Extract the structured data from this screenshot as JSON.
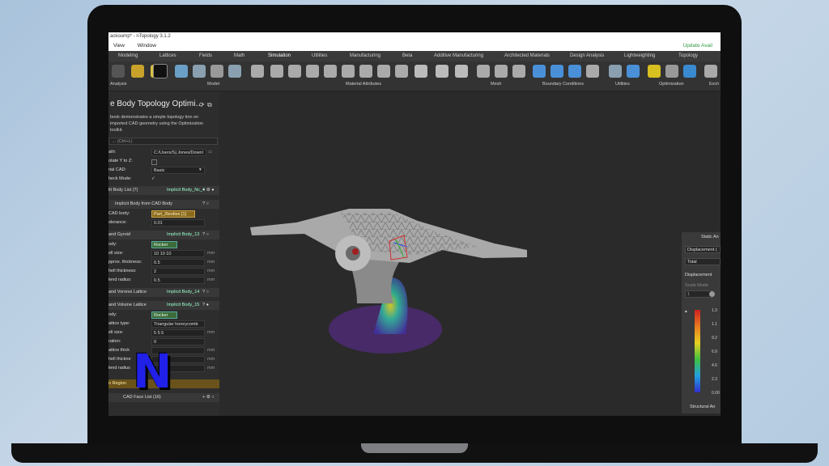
{
  "window": {
    "title": "ackournp* - nTopology 3.1.2",
    "update_link": "Update Avail"
  },
  "menu": [
    "View",
    "Window"
  ],
  "tabs": [
    "Modeling",
    "Lattices",
    "Fields",
    "Math",
    "Simulation",
    "Utilities",
    "Manufacturing",
    "Beta",
    "Additive Manufacturing",
    "Architected Materials",
    "Design Analysis",
    "Lightweighting",
    "Topology Optimizatio"
  ],
  "active_tab": "Simulation",
  "ribbon_groups": [
    "Analysis",
    "Model",
    "Material Attributes",
    "Mesh",
    "Boundary Conditions",
    "Utilities",
    "Optimization",
    "Exch"
  ],
  "notebook": {
    "title": "e Body Topology Optimi…",
    "description": "book demonstrates a simple topology tion on imported CAD geometry using the Optimization toolkit.",
    "search_placeholder": "… (Ctrl+L)",
    "inputs": [
      {
        "label": "ath:",
        "value": "C:/Users/Sj Jones/Downl"
      },
      {
        "label": "otate Y to Z:",
        "value": ""
      },
      {
        "label": "rial CAD:",
        "value": "Basic"
      },
      {
        "label": "heck Mode:",
        "value": "✓"
      }
    ]
  },
  "blocks": [
    {
      "head": "lit Body List (7)",
      "var": "Implicit Body_Nc_4",
      "rows": []
    },
    {
      "head": "Implicit Body from CAD Body",
      "var": "",
      "rows": [
        {
          "label": "CAD body:",
          "value": "Part_2bodies [1]",
          "unit": ""
        },
        {
          "label": "olerance:",
          "value": "0.01",
          "unit": ""
        }
      ]
    },
    {
      "head": "and Gyroid",
      "var": "Implicit Body_13",
      "rows": [
        {
          "label": "ody:",
          "value": "Rocker",
          "unit": ""
        },
        {
          "label": "ell size:",
          "value": "10  10  10",
          "unit": "mm"
        },
        {
          "label": "pprox. thickness:",
          "value": "0.5",
          "unit": "mm"
        },
        {
          "label": "hell thickness:",
          "value": "2",
          "unit": "mm"
        },
        {
          "label": "lend radius:",
          "value": "0.5",
          "unit": "mm"
        }
      ]
    },
    {
      "head": "and Voronoi Lattice",
      "var": "Implicit Body_14",
      "rows": []
    },
    {
      "head": "and Volume Lattice",
      "var": "Implicit Body_15",
      "rows": [
        {
          "label": "ody:",
          "value": "Rocker",
          "unit": ""
        },
        {
          "label": "attice type:",
          "value": "Triangular honeycomb",
          "unit": ""
        },
        {
          "label": "ell size:",
          "value": "5  5  5",
          "unit": "mm"
        },
        {
          "label": "ration:",
          "value": "0",
          "unit": ""
        },
        {
          "label": "attice thick",
          "value": "",
          "unit": "mm"
        },
        {
          "label": "hell thickne",
          "value": "",
          "unit": "mm"
        },
        {
          "label": "lend radius",
          "value": "",
          "unit": "mm"
        }
      ]
    }
  ],
  "footer": {
    "region": "n Region",
    "cad_face_list": "CAD Face List (16)"
  },
  "overlay_logo": "N",
  "right_panel": {
    "title": "Static An",
    "dropdown1": "Displacement (",
    "dropdown2": "Total",
    "label": "Displacement",
    "scale_label": "Scale Mode",
    "scale_value": "1",
    "colorbar_ticks": [
      "1.3",
      "1.1",
      "9.2",
      "6.9",
      "4.6",
      "2.3",
      "0.00"
    ],
    "footer": "Structural An"
  },
  "colors": {
    "accent": "#4fb3e8",
    "panel": "#2d2d2d",
    "viewport": "#2a2a2a",
    "update_green": "#2f9a44"
  }
}
